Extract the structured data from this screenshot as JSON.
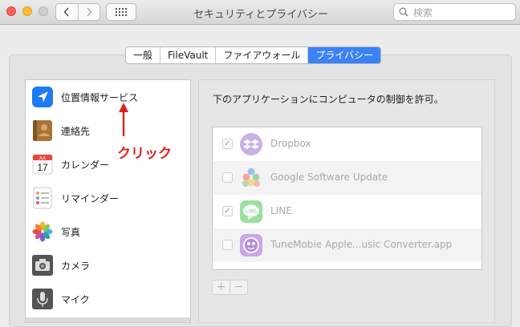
{
  "window": {
    "title": "セキュリティとプライバシー",
    "search_placeholder": "検索"
  },
  "tabs": [
    {
      "label": "一般",
      "active": false
    },
    {
      "label": "FileVault",
      "active": false
    },
    {
      "label": "ファイアウォール",
      "active": false
    },
    {
      "label": "プライバシー",
      "active": true
    }
  ],
  "services": [
    {
      "label": "位置情報サービス",
      "icon": "location-arrow-icon"
    },
    {
      "label": "連絡先",
      "icon": "contacts-book-icon"
    },
    {
      "label": "カレンダー",
      "icon": "calendar-icon",
      "calendar_month": "JUL",
      "calendar_day": "17"
    },
    {
      "label": "リマインダー",
      "icon": "reminders-icon"
    },
    {
      "label": "写真",
      "icon": "photos-icon"
    },
    {
      "label": "カメラ",
      "icon": "camera-icon"
    },
    {
      "label": "マイク",
      "icon": "microphone-icon"
    }
  ],
  "right_pane": {
    "description": "下のアプリケーションにコンピュータの制御を許可。",
    "apps": [
      {
        "name": "Dropbox",
        "checked": true,
        "icon": "dropbox-icon"
      },
      {
        "name": "Google Software Update",
        "checked": false,
        "icon": "google-software-update-icon"
      },
      {
        "name": "LINE",
        "checked": true,
        "icon": "line-icon",
        "icon_text": "LINE"
      },
      {
        "name": "TuneMobie Apple...usic Converter.app",
        "checked": false,
        "icon": "tunemobie-icon"
      }
    ],
    "add_label": "+",
    "remove_label": "−"
  },
  "annotation": {
    "text": "クリック",
    "color": "#e0211c"
  },
  "colors": {
    "accent": "#3b82f6",
    "close": "#fe5f57",
    "minimize": "#febc2e"
  }
}
